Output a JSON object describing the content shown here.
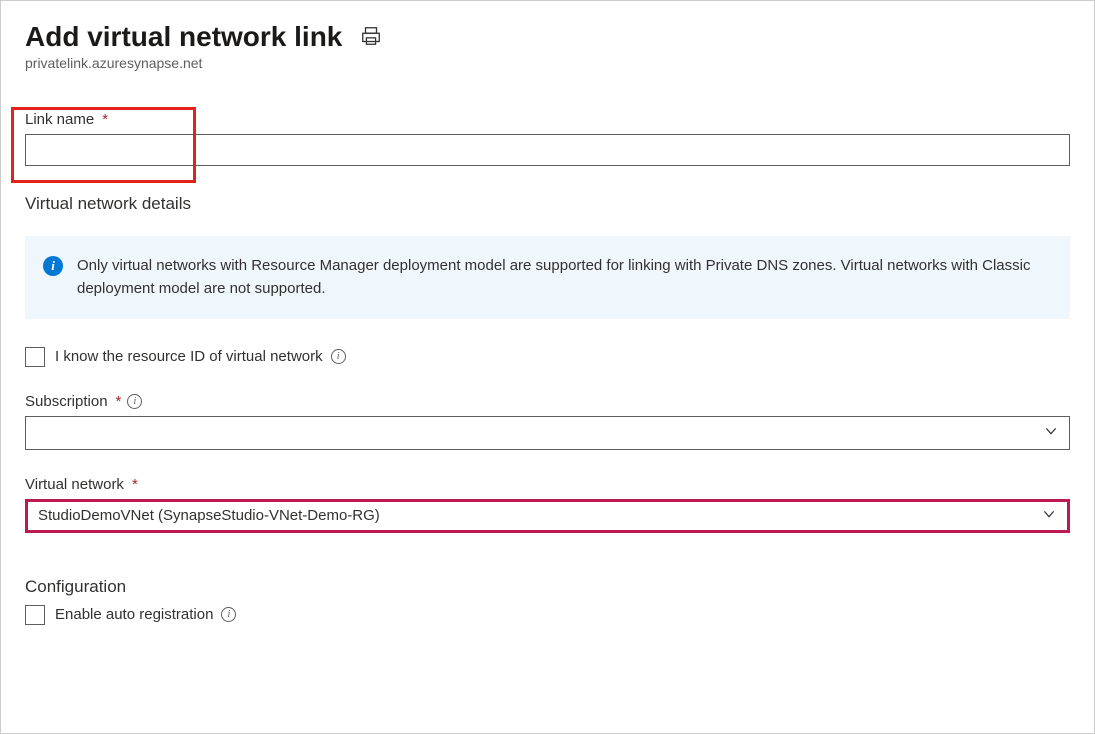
{
  "header": {
    "title": "Add virtual network link",
    "subtitle": "privatelink.azuresynapse.net"
  },
  "fields": {
    "link_name": {
      "label": "Link name",
      "value": ""
    },
    "subscription": {
      "label": "Subscription",
      "value": ""
    },
    "virtual_network": {
      "label": "Virtual network",
      "value": "StudioDemoVNet (SynapseStudio-VNet-Demo-RG)"
    }
  },
  "sections": {
    "vnet_details": "Virtual network details",
    "configuration": "Configuration"
  },
  "info_banner": "Only virtual networks with Resource Manager deployment model are supported for linking with Private DNS zones. Virtual networks with Classic deployment model are not supported.",
  "checkboxes": {
    "know_resource_id": "I know the resource ID of virtual network",
    "enable_auto_registration": "Enable auto registration"
  }
}
